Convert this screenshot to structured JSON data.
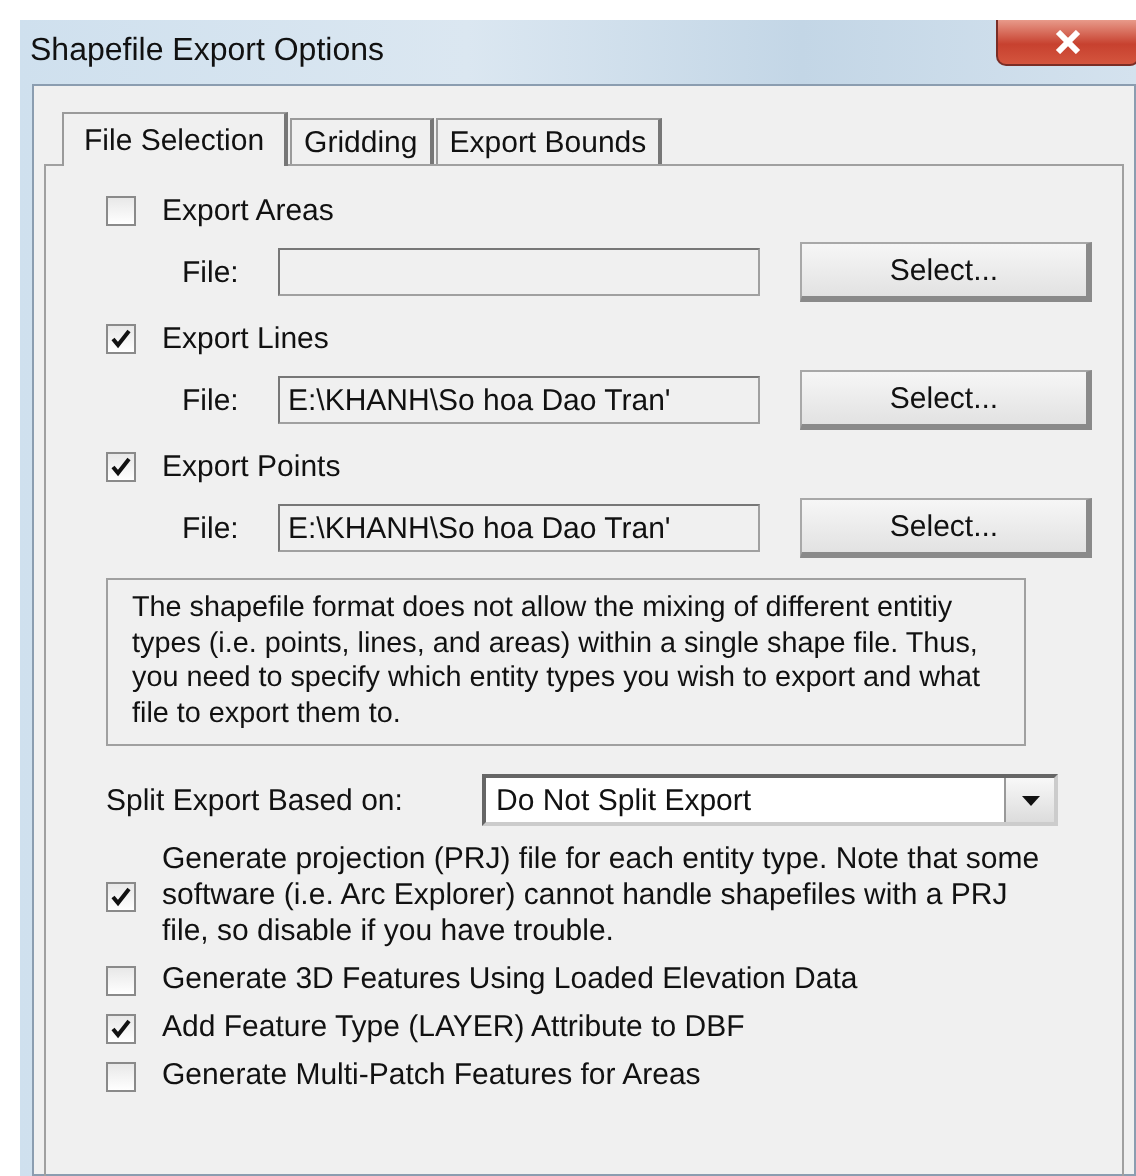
{
  "window": {
    "title": "Shapefile Export Options"
  },
  "tabs": [
    {
      "label": "File Selection",
      "selected": true
    },
    {
      "label": "Gridding",
      "selected": false
    },
    {
      "label": "Export Bounds",
      "selected": false
    }
  ],
  "exports": [
    {
      "label": "Export Areas",
      "checked": false,
      "file_label": "File:",
      "button": "Select..."
    },
    {
      "label": "Export Lines",
      "checked": true,
      "file_label": "File:",
      "file": "E:\\KHANH\\So hoa Dao Tran'",
      "button": "Select..."
    },
    {
      "label": "Export Points",
      "checked": true,
      "file_label": "File:",
      "file": "E:\\KHANH\\So hoa Dao Tran'",
      "button": "Select..."
    }
  ],
  "note": "The shapefile format does not allow the mixing of different entitiy types (i.e. points, lines, and areas) within a single shape file. Thus, you need to specify which entity types you wish to export and what file to export them to.",
  "split": {
    "label": "Split Export Based on:",
    "value": "Do Not Split Export"
  },
  "options": [
    {
      "label": "Generate projection (PRJ) file for each entity type. Note that some software (i.e. Arc Explorer) cannot handle shapefiles with a PRJ file, so disable if you have trouble.",
      "checked": true
    },
    {
      "label": "Generate 3D Features Using Loaded Elevation Data",
      "checked": false
    },
    {
      "label": "Add Feature Type (LAYER) Attribute to DBF",
      "checked": true
    },
    {
      "label": "Generate Multi-Patch Features for Areas",
      "checked": false
    }
  ]
}
